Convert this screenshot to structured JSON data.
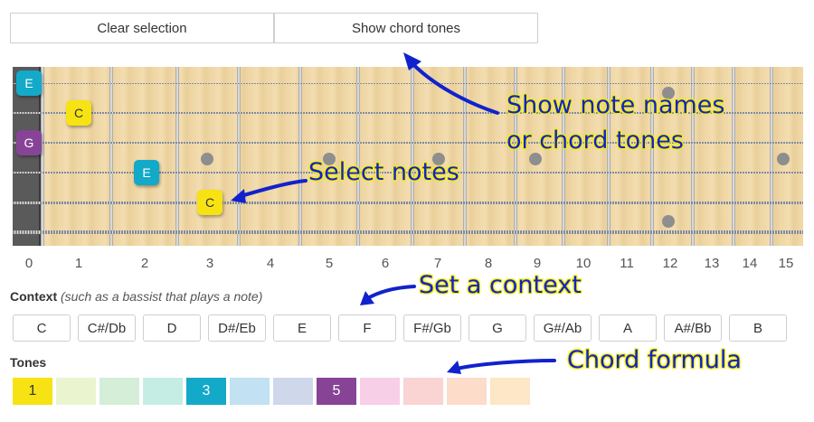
{
  "toolbar": {
    "clear_label": "Clear selection",
    "show_label": "Show chord tones"
  },
  "fretboard": {
    "fret_numbers": [
      "0",
      "1",
      "2",
      "3",
      "4",
      "5",
      "6",
      "7",
      "8",
      "9",
      "10",
      "11",
      "12",
      "13",
      "14",
      "15"
    ],
    "selected_notes": [
      {
        "note": "E",
        "string": 1,
        "fret": 0,
        "color": "#13a9c9"
      },
      {
        "note": "C",
        "string": 2,
        "fret": 1,
        "color": "#f7e313"
      },
      {
        "note": "G",
        "string": 3,
        "fret": 0,
        "color": "#874496"
      },
      {
        "note": "E",
        "string": 4,
        "fret": 2,
        "color": "#13a9c9"
      },
      {
        "note": "C",
        "string": 5,
        "fret": 3,
        "color": "#f7e313"
      }
    ]
  },
  "context": {
    "label_bold": "Context",
    "label_hint": "(such as a bassist that plays a note)",
    "notes": [
      "C",
      "C#/Db",
      "D",
      "D#/Eb",
      "E",
      "F",
      "F#/Gb",
      "G",
      "G#/Ab",
      "A",
      "A#/Bb",
      "B"
    ]
  },
  "tones": {
    "label": "Tones",
    "cells": [
      {
        "text": "1",
        "color": "#f7e313"
      },
      {
        "text": "",
        "color": "#eaf5cf"
      },
      {
        "text": "",
        "color": "#d5eed7"
      },
      {
        "text": "",
        "color": "#c5ede4"
      },
      {
        "text": "3",
        "color": "#13a9c9"
      },
      {
        "text": "",
        "color": "#c2e1f2"
      },
      {
        "text": "",
        "color": "#cfd8ea"
      },
      {
        "text": "5",
        "color": "#874496"
      },
      {
        "text": "",
        "color": "#f7cfe6"
      },
      {
        "text": "",
        "color": "#fad3d3"
      },
      {
        "text": "",
        "color": "#fddcc9"
      },
      {
        "text": "",
        "color": "#fde7c7"
      }
    ]
  },
  "annotations": {
    "show_names_line1": "Show note names",
    "show_names_line2": "or chord tones",
    "select_notes": "Select notes",
    "set_context": "Set a context",
    "chord_formula": "Chord formula"
  },
  "colors": {
    "annotation_text": "#1122cc",
    "annotation_glow": "#f5f000",
    "cyan": "#13a9c9",
    "yellow": "#f7e313",
    "purple": "#874496"
  }
}
